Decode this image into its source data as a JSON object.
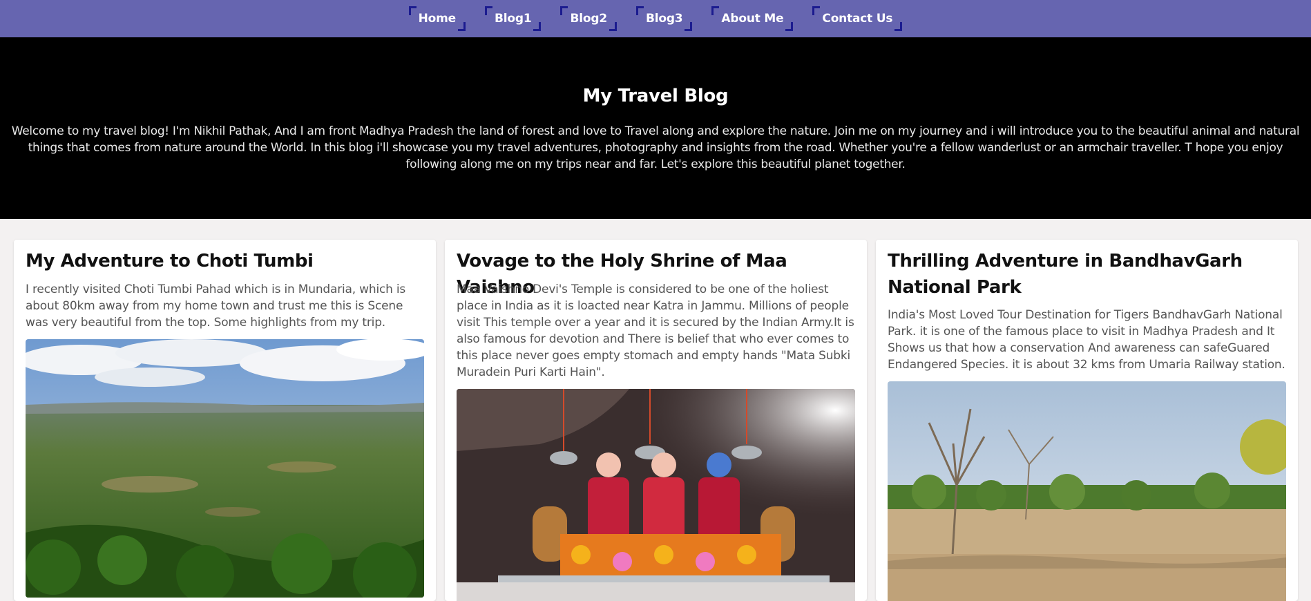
{
  "nav": {
    "items": [
      {
        "label": "Home"
      },
      {
        "label": "Blog1"
      },
      {
        "label": "Blog2"
      },
      {
        "label": "Blog3"
      },
      {
        "label": "About Me"
      },
      {
        "label": "Contact Us"
      }
    ]
  },
  "hero": {
    "title": "My Travel Blog",
    "text": "Welcome to my travel blog! I'm Nikhil Pathak, And I am front Madhya Pradesh the land of forest and love to Travel along and explore the nature. Join me on my journey and i will introduce you to the beautiful animal and natural things that comes from nature around the World. In this blog i'll showcase you my travel adventures, photography and insights from the road. Whether you're a fellow wanderlust or an armchair traveller. T hope you enjoy following along me on my trips near and far. Let's explore this beautiful planet together."
  },
  "cards": [
    {
      "title": "My Adventure to Choti Tumbi",
      "text": "I recently visited Choti Tumbi Pahad which is in Mundaria, which is about 80km away from my home town and trust me this is Scene was very beautiful from the top. Some highlights from my trip."
    },
    {
      "title": "Vovage to the Holy Shrine of Maa Vaishno",
      "text": "Maa Vaishno Devi's Temple is considered to be one of the holiest place in India as it is loacted near Katra in Jammu. Millions of people visit This temple over a year and it is secured by the Indian Army.It is also famous for devotion and There is belief that who ever comes to this place never goes empty stomach and empty hands \"Mata Subki Muradein Puri Karti Hain\"."
    },
    {
      "title": "Thrilling Adventure in BandhavGarh National Park",
      "text": "India's Most Loved Tour Destination for Tigers BandhavGarh National Park. it is one of the famous place to visit in Madhya Pradesh and It Shows us that how a conservation And awareness can safeGuared Endangered Species. it is about 32 kms from Umaria Railway station."
    }
  ],
  "colors": {
    "nav_bg": "#6665b0",
    "nav_bracket": "#1b1b8f",
    "hero_bg": "#000000",
    "page_bg": "#f3f1f1"
  }
}
